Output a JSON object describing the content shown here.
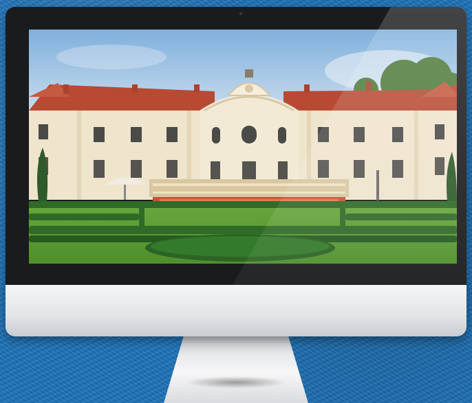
{
  "scene": {
    "background": "blue-textured-backdrop",
    "device": "desktop-monitor",
    "screen_content": "palace-with-formal-garden-photo",
    "colors": {
      "backdrop": "#1e73b8",
      "bezel": "#1a1b1d",
      "chin": "#e3e5e7",
      "sky": "#8fb8dc",
      "roof": "#b84a34",
      "facade": "#efe4cc",
      "hedge": "#2f6b27",
      "lawn": "#5fa33a"
    }
  }
}
